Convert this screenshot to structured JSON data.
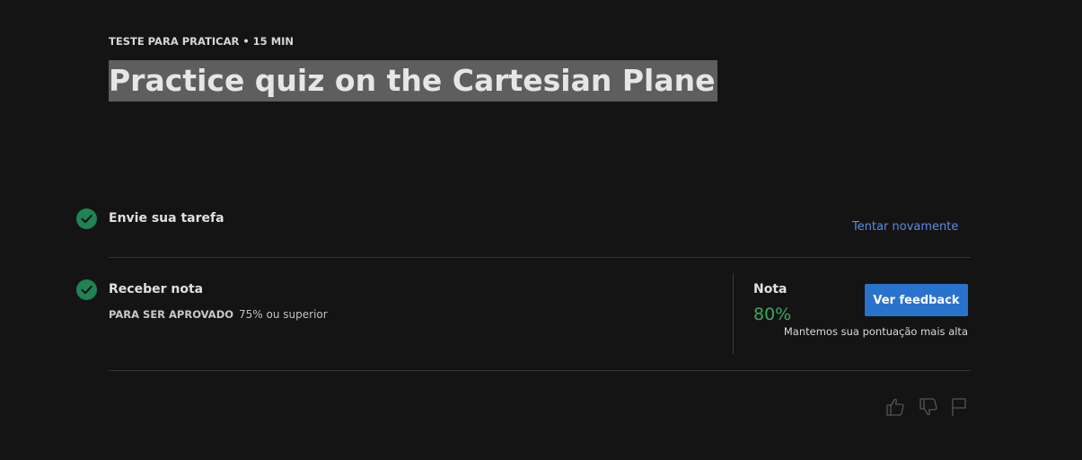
{
  "header": {
    "eyebrow": "TESTE PARA PRATICAR • 15 MIN",
    "title": "Practice quiz on the Cartesian Plane"
  },
  "steps": [
    {
      "title": "Envie sua tarefa",
      "status_icon": "check-circle-icon",
      "action_label": "Tentar novamente"
    },
    {
      "title": "Receber nota",
      "status_icon": "check-circle-icon",
      "pass_label": "PARA SER APROVADO",
      "pass_value": "75% ou superior"
    }
  ],
  "grade": {
    "label": "Nota",
    "value": "80%",
    "button_label": "Ver feedback",
    "note": "Mantemos sua pontuação mais alta"
  },
  "footer_icons": [
    "thumbs-up-icon",
    "thumbs-down-icon",
    "flag-icon"
  ],
  "colors": {
    "background": "#141414",
    "check": "#1f8354",
    "link": "#5b8de6",
    "button": "#2a73cc",
    "grade": "#3fa55f",
    "title_highlight": "#5e5e5e"
  }
}
